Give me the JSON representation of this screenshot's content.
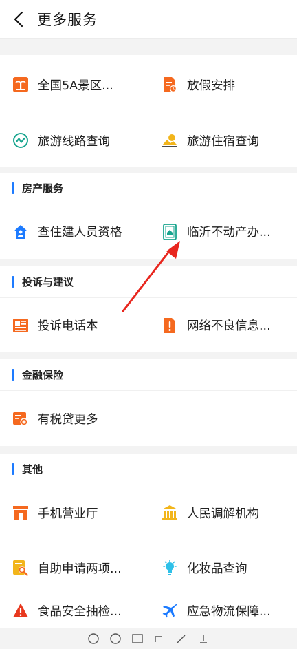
{
  "header": {
    "title": "更多服务"
  },
  "section_top": {
    "items": [
      {
        "label": "全国5A景区...",
        "icon": "palm-tree-icon"
      },
      {
        "label": "放假安排",
        "icon": "document-clock-icon"
      },
      {
        "label": "旅游线路查询",
        "icon": "route-icon"
      },
      {
        "label": "旅游住宿查询",
        "icon": "sun-hill-icon"
      }
    ]
  },
  "section_housing": {
    "title": "房产服务",
    "items": [
      {
        "label": "查住建人员资格",
        "icon": "house-person-icon"
      },
      {
        "label": "临沂不动产办...",
        "icon": "property-card-icon"
      }
    ]
  },
  "section_complaint": {
    "title": "投诉与建议",
    "items": [
      {
        "label": "投诉电话本",
        "icon": "newspaper-icon"
      },
      {
        "label": "网络不良信息...",
        "icon": "alert-document-icon"
      }
    ]
  },
  "section_finance": {
    "title": "金融保险",
    "items": [
      {
        "label": "有税贷更多",
        "icon": "loan-icon"
      }
    ]
  },
  "section_other": {
    "title": "其他",
    "items": [
      {
        "label": "手机营业厅",
        "icon": "store-icon"
      },
      {
        "label": "人民调解机构",
        "icon": "institution-icon"
      },
      {
        "label": "自助申请两项...",
        "icon": "document-search-icon"
      },
      {
        "label": "化妆品查询",
        "icon": "bulb-icon"
      },
      {
        "label": "食品安全抽检...",
        "icon": "warning-icon"
      },
      {
        "label": "应急物流保障...",
        "icon": "airplane-icon"
      }
    ]
  },
  "colors": {
    "accent": "#1d7bff",
    "orange": "#f5691f",
    "teal": "#19a58f",
    "gold": "#f2b51b",
    "annotation_arrow": "#e8261e"
  }
}
